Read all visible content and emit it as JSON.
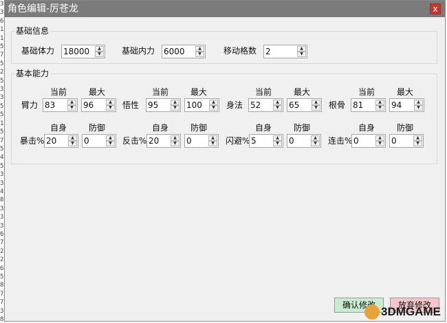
{
  "window": {
    "title": "角色编辑-厉苍龙",
    "close_label": "x"
  },
  "gutter_digits": [
    "3",
    "3",
    "6",
    "1",
    "1",
    "5",
    "7",
    "5",
    "2",
    "5",
    "3",
    "3",
    "5",
    "5",
    "1",
    "5",
    "7",
    "5",
    "4",
    "5",
    "3",
    "3",
    "4",
    "8",
    "3",
    "3",
    "3",
    "6",
    "7",
    "2",
    "2",
    "6",
    "5",
    "8",
    "7",
    "7",
    "3",
    "8"
  ],
  "basic_info": {
    "legend": "基础信息",
    "fields": [
      {
        "label": "基础体力",
        "value": "18000"
      },
      {
        "label": "基础内力",
        "value": "6000"
      },
      {
        "label": "移动格数",
        "value": "2"
      }
    ]
  },
  "abilities": {
    "legend": "基本能力",
    "stat_headers": {
      "current": "当前",
      "max": "最大"
    },
    "stats": [
      {
        "label": "臂力",
        "current": "83",
        "max": "96"
      },
      {
        "label": "悟性",
        "current": "95",
        "max": "100"
      },
      {
        "label": "身法",
        "current": "52",
        "max": "65"
      },
      {
        "label": "根骨",
        "current": "81",
        "max": "94"
      }
    ],
    "effect_headers": {
      "self": "自身",
      "defense": "防御"
    },
    "effects": [
      {
        "label": "暴击%",
        "self": "20",
        "defense": "0"
      },
      {
        "label": "反击%",
        "self": "20",
        "defense": "0"
      },
      {
        "label": "闪避%",
        "self": "5",
        "defense": "0"
      },
      {
        "label": "连击%",
        "self": "0",
        "defense": "0"
      }
    ]
  },
  "buttons": {
    "confirm": "确认修改",
    "discard": "放弃修改"
  },
  "watermark": {
    "text": "3DMGAME"
  },
  "colors": {
    "titlebar": "#7b7b7b",
    "close": "#c23a2e",
    "confirm_bg": "#c9ebd0",
    "discard_bg": "#f4c6c9"
  }
}
